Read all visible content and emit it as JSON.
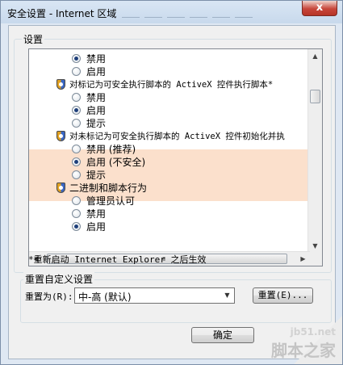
{
  "window": {
    "title": "安全设置 - Internet 区域",
    "close_glyph": "x"
  },
  "settings": {
    "label": "设置",
    "items": [
      {
        "kind": "radio",
        "label": "禁用",
        "checked": true
      },
      {
        "kind": "radio",
        "label": "启用",
        "checked": false
      },
      {
        "kind": "header",
        "label": "对标记为可安全执行脚本的 ActiveX 控件执行脚本*"
      },
      {
        "kind": "radio",
        "label": "禁用",
        "checked": false
      },
      {
        "kind": "radio",
        "label": "启用",
        "checked": true
      },
      {
        "kind": "radio",
        "label": "提示",
        "checked": false
      },
      {
        "kind": "header",
        "label": "对未标记为可安全执行脚本的 ActiveX 控件初始化并执"
      },
      {
        "kind": "radio",
        "label": "禁用 (推荐)",
        "checked": false
      },
      {
        "kind": "radio",
        "label": "启用 (不安全)",
        "checked": true
      },
      {
        "kind": "radio",
        "label": "提示",
        "checked": false
      },
      {
        "kind": "header",
        "label": "二进制和脚本行为"
      },
      {
        "kind": "radio",
        "label": "管理员认可",
        "checked": false
      },
      {
        "kind": "radio",
        "label": "禁用",
        "checked": false
      },
      {
        "kind": "radio",
        "label": "启用",
        "checked": true
      }
    ]
  },
  "restart_note": "*重新启动 Internet Explorer 之后生效",
  "reset": {
    "group_label": "重置自定义设置",
    "reset_to_label": "重置为(R):",
    "select_value": "中-高 (默认)",
    "reset_button": "重置(E)..."
  },
  "ok_button": "确定",
  "watermark": {
    "url": "jb51.net",
    "text": "脚本之家"
  }
}
